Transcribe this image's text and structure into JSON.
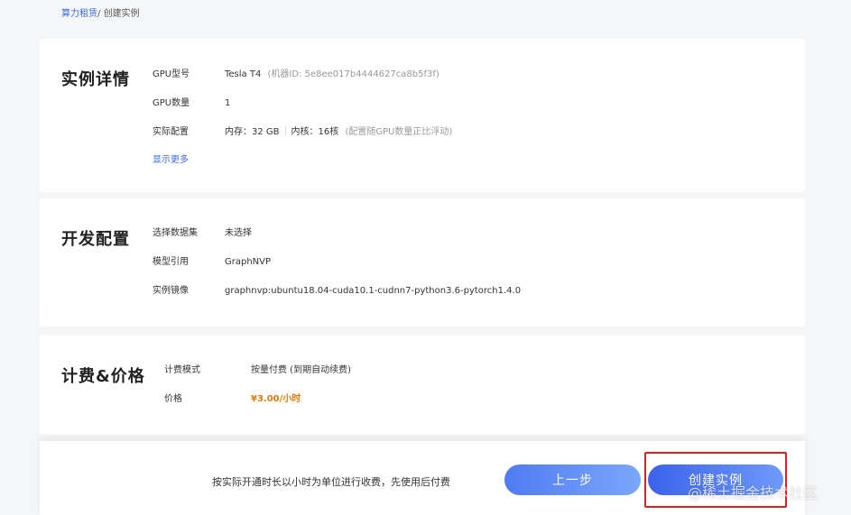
{
  "breadcrumb": {
    "parent": "算力租赁",
    "separator": "/ ",
    "current": "创建实例"
  },
  "instance": {
    "title": "实例详情",
    "gpu_type_label": "GPU型号",
    "gpu_type_value": "Tesla T4",
    "gpu_machine_id": "(机器ID: 5e8ee017b4444627ca8b5f3f)",
    "gpu_count_label": "GPU数量",
    "gpu_count_value": "1",
    "config_label": "实际配置",
    "memory": "内存：32 GB",
    "cores": "内核：16核",
    "config_note": "(配置随GPU数量正比浮动)",
    "show_more": "显示更多"
  },
  "dev": {
    "title": "开发配置",
    "dataset_label": "选择数据集",
    "dataset_value": "未选择",
    "model_label": "模型引用",
    "model_value": "GraphNVP",
    "image_label": "实例镜像",
    "image_value": "graphnvp:ubuntu18.04-cuda10.1-cudnn7-python3.6-pytorch1.4.0"
  },
  "billing": {
    "title": "计费&价格",
    "mode_label": "计费模式",
    "mode_value": "按量付费 (到期自动续费)",
    "price_label": "价格",
    "price_value": "¥3.00/小时"
  },
  "footer": {
    "note": "按实际开通时长以小时为单位进行收费，先使用后付费",
    "prev_label": "上一步",
    "create_label": "创建实例"
  },
  "watermark": "@稀土掘金技术社区",
  "colors": {
    "accent": "#3c6be8",
    "price": "#e07b0a",
    "highlight": "#e0201e"
  }
}
